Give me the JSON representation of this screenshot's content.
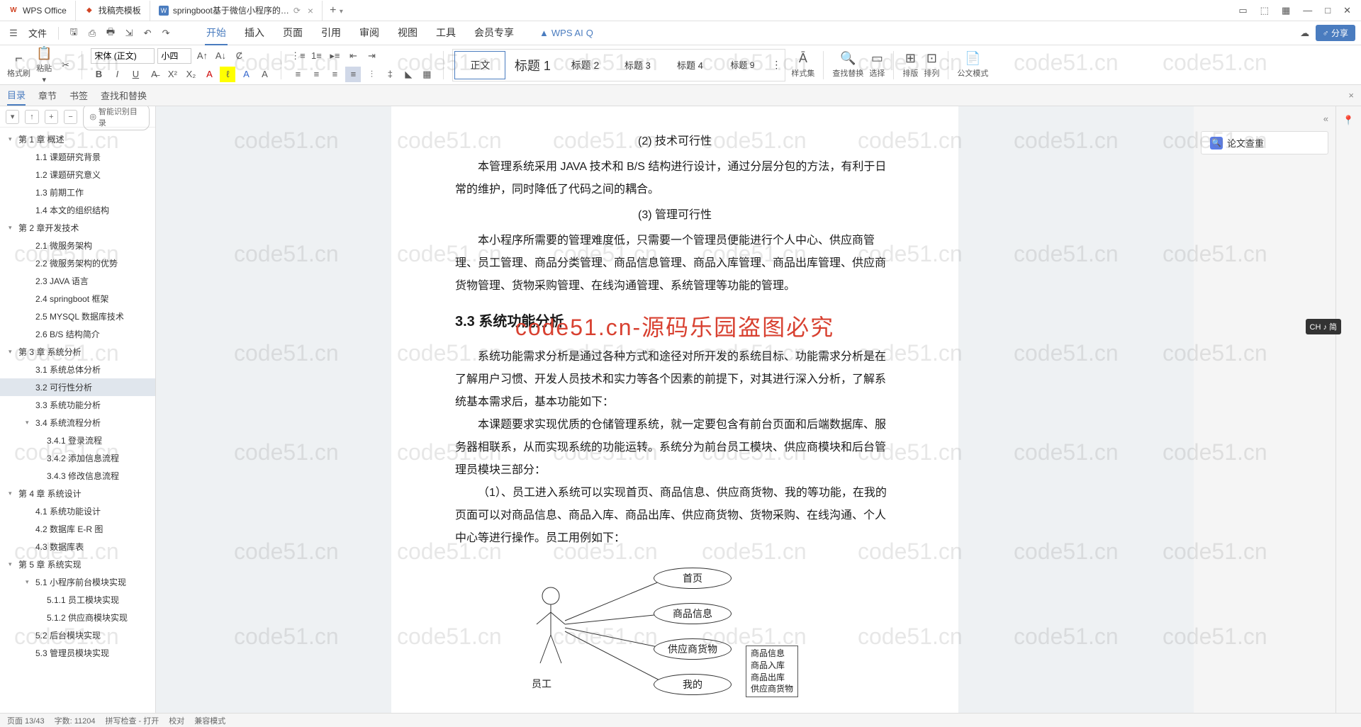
{
  "tabs": {
    "wps": "WPS Office",
    "gao": "找稿壳模板",
    "doc": "springboot基于微信小程序的…",
    "add": "+"
  },
  "win": {
    "min": "—",
    "max": "□",
    "close": "✕"
  },
  "menurow": {
    "file": "文件",
    "tabs": [
      "开始",
      "插入",
      "页面",
      "引用",
      "审阅",
      "视图",
      "工具",
      "会员专享"
    ],
    "active": "开始",
    "ai": "WPS AI",
    "share": "分享"
  },
  "ribbon": {
    "format_brush": "格式刷",
    "paste": "粘贴",
    "font_name": "宋体 (正文)",
    "font_size": "小四",
    "styles": [
      "正文",
      "标题 1",
      "标题 2",
      "标题 3",
      "标题 4",
      "标题 9"
    ],
    "style_active": "正文",
    "style_set": "样式集",
    "find": "查找替换",
    "select": "选择",
    "sort": "排版",
    "arrange": "排列",
    "gov": "公文模式"
  },
  "nav": {
    "tabs": [
      "目录",
      "章节",
      "书签",
      "查找和替换"
    ],
    "active": "目录",
    "smart": "智能识别目录"
  },
  "toc": [
    {
      "l": 1,
      "t": "第 1 章 概述",
      "c": true
    },
    {
      "l": 2,
      "t": "1.1 课题研究背景"
    },
    {
      "l": 2,
      "t": "1.2 课题研究意义"
    },
    {
      "l": 2,
      "t": "1.3 前期工作"
    },
    {
      "l": 2,
      "t": "1.4 本文的组织结构"
    },
    {
      "l": 1,
      "t": "第 2 章开发技术",
      "c": true
    },
    {
      "l": 2,
      "t": "2.1 微服务架构"
    },
    {
      "l": 2,
      "t": "2.2 微服务架构的优势"
    },
    {
      "l": 2,
      "t": "2.3 JAVA 语言"
    },
    {
      "l": 2,
      "t": "2.4 springboot 框架"
    },
    {
      "l": 2,
      "t": "2.5 MYSQL 数据库技术"
    },
    {
      "l": 2,
      "t": "2.6 B/S 结构简介"
    },
    {
      "l": 1,
      "t": "第 3 章 系统分析",
      "c": true
    },
    {
      "l": 2,
      "t": "3.1 系统总体分析"
    },
    {
      "l": 2,
      "t": "3.2 可行性分析",
      "sel": true
    },
    {
      "l": 2,
      "t": "3.3 系统功能分析"
    },
    {
      "l": 2,
      "t": "3.4 系统流程分析",
      "c": true
    },
    {
      "l": 3,
      "t": "3.4.1 登录流程"
    },
    {
      "l": 3,
      "t": "3.4.2 添加信息流程"
    },
    {
      "l": 3,
      "t": "3.4.3 修改信息流程"
    },
    {
      "l": 1,
      "t": "第 4 章 系统设计",
      "c": true
    },
    {
      "l": 2,
      "t": "4.1 系统功能设计"
    },
    {
      "l": 2,
      "t": "4.2 数据库 E-R 图"
    },
    {
      "l": 2,
      "t": "4.3 数据库表"
    },
    {
      "l": 1,
      "t": "第 5 章 系统实现",
      "c": true
    },
    {
      "l": 2,
      "t": "5.1 小程序前台模块实现",
      "c": true
    },
    {
      "l": 3,
      "t": "5.1.1 员工模块实现"
    },
    {
      "l": 3,
      "t": "5.1.2 供应商模块实现"
    },
    {
      "l": 2,
      "t": "5.2 后台模块实现"
    },
    {
      "l": 2,
      "t": "5.3 管理员模块实现"
    }
  ],
  "doc": {
    "item2": "(2) 技术可行性",
    "p1": "本管理系统采用 JAVA 技术和 B/S 结构进行设计，通过分层分包的方法，有利于日常的维护，同时降低了代码之间的耦合。",
    "item3": "(3) 管理可行性",
    "p2": "本小程序所需要的管理难度低，只需要一个管理员便能进行个人中心、供应商管理、员工管理、商品分类管理、商品信息管理、商品入库管理、商品出库管理、供应商货物管理、货物采购管理、在线沟通管理、系统管理等功能的管理。",
    "h3": "3.3 系统功能分析",
    "p3": "系统功能需求分析是通过各种方式和途径对所开发的系统目标、功能需求分析是在了解用户习惯、开发人员技术和实力等各个因素的前提下，对其进行深入分析，了解系统基本需求后，基本功能如下：",
    "p4": "本课题要求实现优质的仓储管理系统，就一定要包含有前台页面和后端数据库、服务器相联系，从而实现系统的功能运转。系统分为前台员工模块、供应商模块和后台管理员模块三部分：",
    "p5": "（1）、员工进入系统可以实现首页、商品信息、供应商货物、我的等功能，在我的页面可以对商品信息、商品入库、商品出库、供应商货物、货物采购、在线沟通、个人中心等进行操作。员工用例如下：",
    "red": "code51.cn-源码乐园盗图必究",
    "actor": "员工",
    "ovals": [
      "首页",
      "商品信息",
      "供应商货物",
      "我的"
    ],
    "box": "商品信息\n商品入库\n商品出库\n供应商货物"
  },
  "rail": {
    "check": "论文查重"
  },
  "ime": "CH ♪ 简",
  "watermark": "code51.cn",
  "status": {
    "page": "页面 13/43",
    "words": "字数: 11204",
    "spell": "拼写检查 - 打开",
    "doc": "校对",
    "mode": "兼容模式"
  }
}
